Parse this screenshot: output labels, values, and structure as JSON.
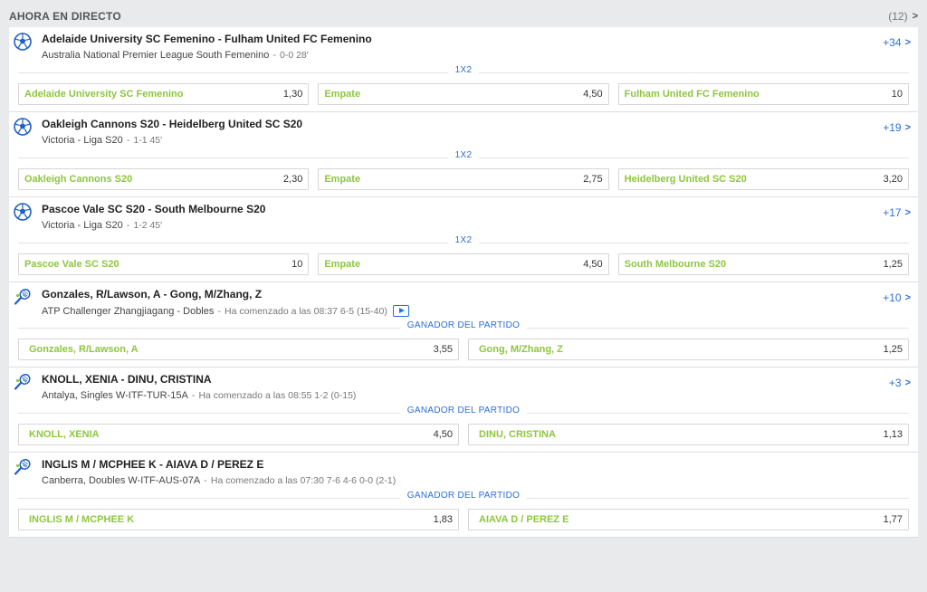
{
  "header": {
    "title": "AHORA EN DIRECTO",
    "count": "(12)"
  },
  "events": [
    {
      "sport": "soccer-ball-icon",
      "title": "Adelaide University SC Femenino - Fulham United FC Femenino",
      "league": "Australia National Premier League South Femenino",
      "live": "0-0 28'",
      "more": "+34",
      "market": "1X2",
      "odds": [
        {
          "sel": "Adelaide University SC Femenino",
          "val": "1,30"
        },
        {
          "sel": "Empate",
          "val": "4,50"
        },
        {
          "sel": "Fulham United FC Femenino",
          "val": "10"
        }
      ]
    },
    {
      "sport": "soccer-ball-icon",
      "title": "Oakleigh Cannons S20 - Heidelberg United SC S20",
      "league": "Victoria - Liga S20",
      "live": "1-1 45'",
      "more": "+19",
      "market": "1X2",
      "odds": [
        {
          "sel": "Oakleigh Cannons S20",
          "val": "2,30"
        },
        {
          "sel": "Empate",
          "val": "2,75"
        },
        {
          "sel": "Heidelberg United SC S20",
          "val": "3,20"
        }
      ]
    },
    {
      "sport": "soccer-ball-icon",
      "title": "Pascoe Vale SC S20 - South Melbourne S20",
      "league": "Victoria - Liga S20",
      "live": "1-2 45'",
      "more": "+17",
      "market": "1X2",
      "odds": [
        {
          "sel": "Pascoe Vale SC S20",
          "val": "10"
        },
        {
          "sel": "Empate",
          "val": "4,50"
        },
        {
          "sel": "South Melbourne S20",
          "val": "1,25"
        }
      ]
    },
    {
      "sport": "tennis-racket-icon",
      "title": "Gonzales, R/Lawson, A - Gong, M/Zhang, Z",
      "league": "ATP Challenger Zhangjiagang - Dobles",
      "live": "Ha comenzado a las 08:37 6-5 (15-40)",
      "video": true,
      "more": "+10",
      "market": "GANADOR DEL PARTIDO",
      "odds": [
        {
          "sel": "Gonzales, R/Lawson, A",
          "val": "3,55"
        },
        {
          "sel": "Gong, M/Zhang, Z",
          "val": "1,25"
        }
      ]
    },
    {
      "sport": "tennis-racket-icon",
      "title": "KNOLL, XENIA - DINU, CRISTINA",
      "league": "Antalya, Singles W-ITF-TUR-15A",
      "live": "Ha comenzado a las 08:55 1-2 (0-15)",
      "more": "+3",
      "market": "GANADOR DEL PARTIDO",
      "odds": [
        {
          "sel": "KNOLL, XENIA",
          "val": "4,50"
        },
        {
          "sel": "DINU, CRISTINA",
          "val": "1,13"
        }
      ]
    },
    {
      "sport": "tennis-racket-icon",
      "title": "INGLIS M / MCPHEE K - AIAVA D / PEREZ E",
      "league": "Canberra, Doubles W-ITF-AUS-07A",
      "live": "Ha comenzado a las 07:30 7-6 4-6 0-0 (2-1)",
      "more": "",
      "market": "GANADOR DEL PARTIDO",
      "odds": [
        {
          "sel": "INGLIS M / MCPHEE K",
          "val": "1,83"
        },
        {
          "sel": "AIAVA D / PEREZ E",
          "val": "1,77"
        }
      ]
    }
  ],
  "colors": {
    "accent": "#2b6fd6",
    "selection": "#8dc63f"
  }
}
